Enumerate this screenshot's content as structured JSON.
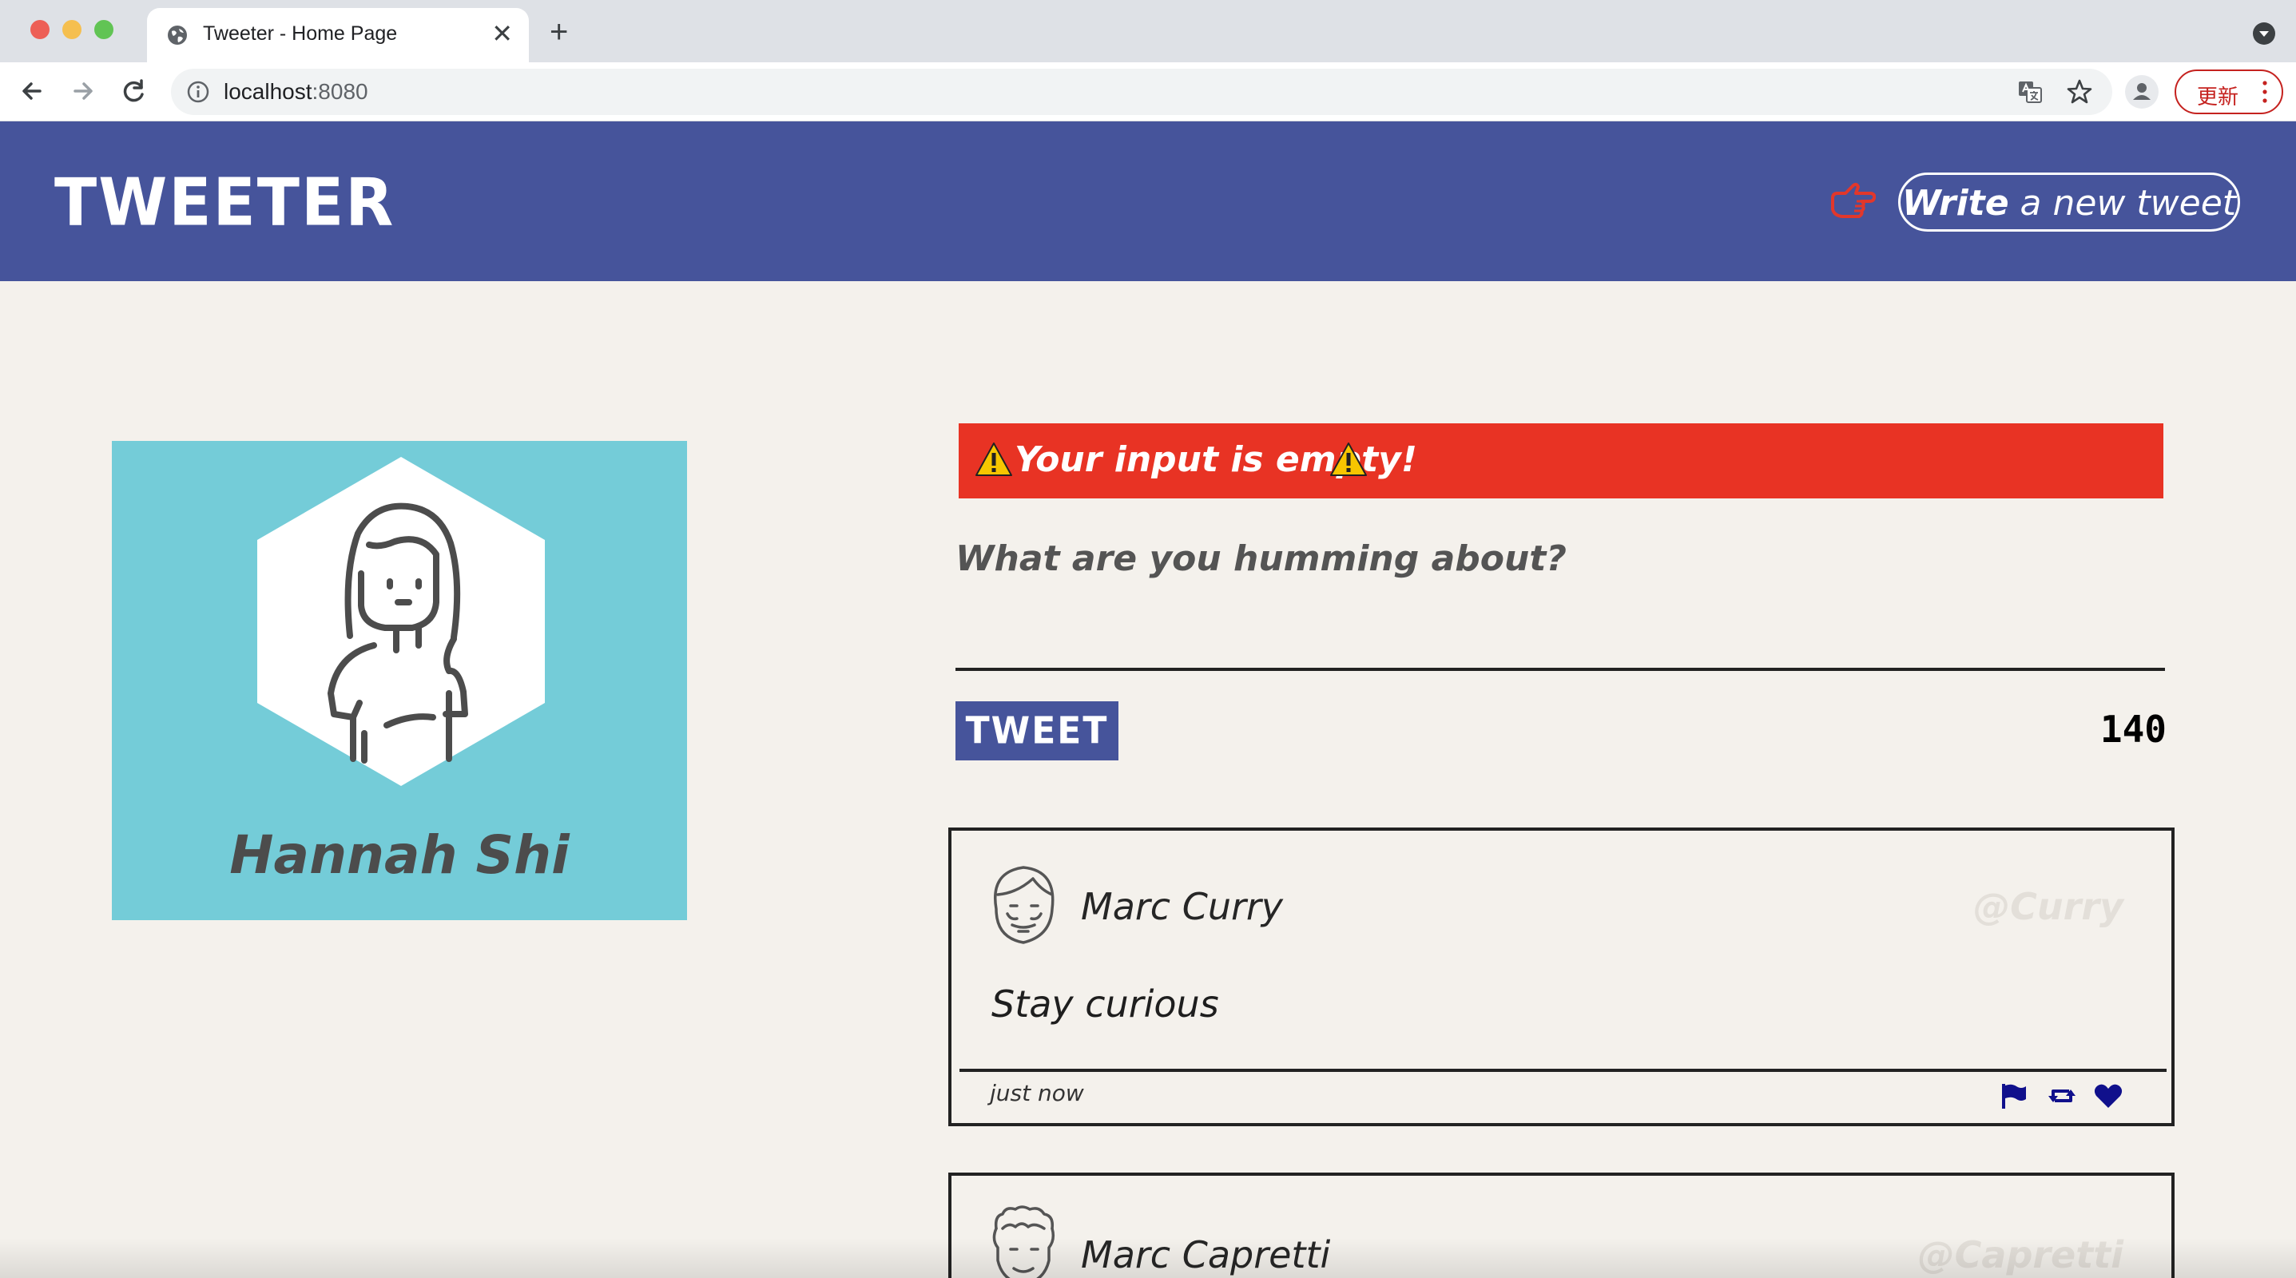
{
  "browser": {
    "tab_title": "Tweeter - Home Page",
    "new_tab_symbol": "+",
    "close_symbol": "✕",
    "url_host": "localhost",
    "url_port": ":8080",
    "update_label": "更新",
    "icons": [
      "globe-icon",
      "back-icon",
      "forward-icon",
      "reload-icon",
      "info-icon",
      "translate-icon",
      "star-icon",
      "profile-icon",
      "more-icon"
    ]
  },
  "header": {
    "brand": "Tweeter",
    "compose_bold": "Write",
    "compose_rest": " a new tweet",
    "brand_color": "#46549b",
    "hand_color": "#e2372b"
  },
  "profile": {
    "name": "Hannah Shi",
    "card_color": "#74ccd8"
  },
  "composer": {
    "error_message": "Your input is empty!",
    "error_color": "#e83324",
    "prompt": "What are you humming about?",
    "textarea_value": "",
    "submit_label": "TWEET",
    "counter": "140"
  },
  "tweets": [
    {
      "name": "Marc Curry",
      "handle": "@Curry",
      "content": "Stay curious",
      "time": "just now",
      "actions": [
        "flag-icon",
        "retweet-icon",
        "heart-icon"
      ],
      "action_color": "#10108c"
    },
    {
      "name": "Marc Capretti",
      "handle": "@Capretti"
    }
  ]
}
